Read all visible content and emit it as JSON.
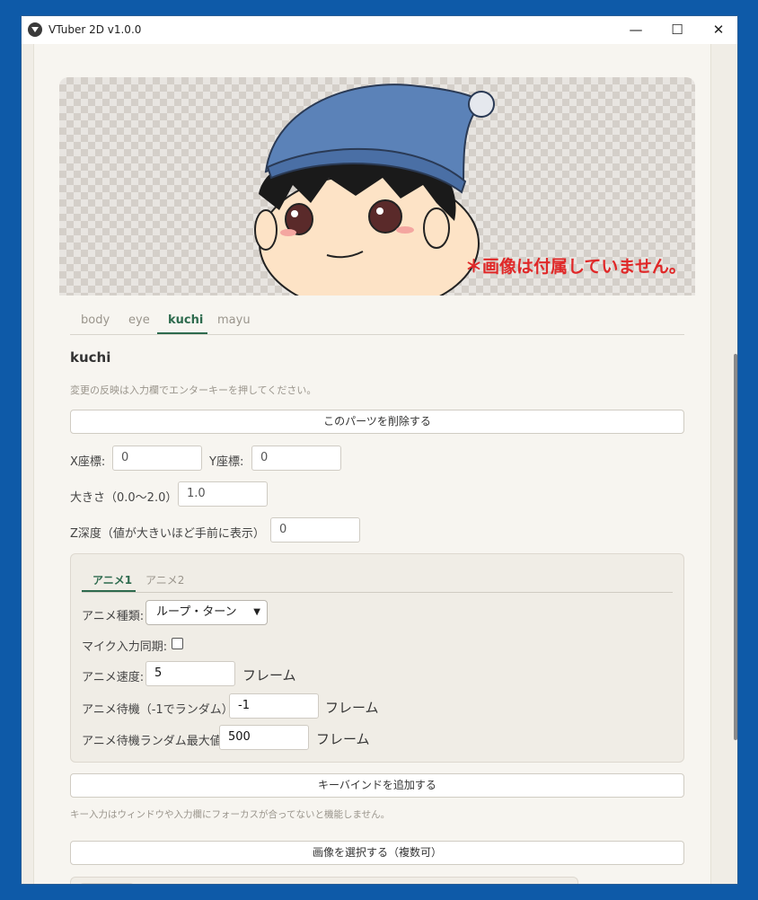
{
  "window": {
    "title": "VTuber 2D v1.0.0",
    "minimize": "—",
    "maximize": "☐",
    "close": "✕"
  },
  "preview": {
    "notice": "＊画像は付属していません。"
  },
  "tabs": [
    {
      "label": "body"
    },
    {
      "label": "eye"
    },
    {
      "label": "kuchi"
    },
    {
      "label": "mayu"
    }
  ],
  "part": {
    "name": "kuchi",
    "hint": "変更の反映は入力欄でエンターキーを押してください。",
    "delete_button": "このパーツを削除する",
    "x_label": "X座標:",
    "x_value": "0",
    "y_label": "Y座標:",
    "y_value": "0",
    "size_label": "大きさ（0.0〜2.0）",
    "size_value": "1.0",
    "z_label": "Z深度（値が大きいほど手前に表示）",
    "z_value": "0"
  },
  "anim": {
    "tabs": [
      {
        "label": "アニメ1"
      },
      {
        "label": "アニメ2"
      }
    ],
    "type_label": "アニメ種類:",
    "type_value": "ループ・ターン",
    "mic_label": "マイク入力同期:",
    "speed_label": "アニメ速度:",
    "speed_value": "5",
    "speed_unit": "フレーム",
    "wait_label": "アニメ待機（-1でランダム）:",
    "wait_value": "-1",
    "wait_unit": "フレーム",
    "rand_label": "アニメ待機ランダム最大値:",
    "rand_value": "500",
    "rand_unit": "フレーム"
  },
  "keybind": {
    "add_button": "キーバインドを追加する",
    "hint": "キー入力はウィンドウや入力欄にフォーカスが合ってないと機能しません。"
  },
  "images": {
    "select_button": "画像を選択する（複数可）"
  }
}
